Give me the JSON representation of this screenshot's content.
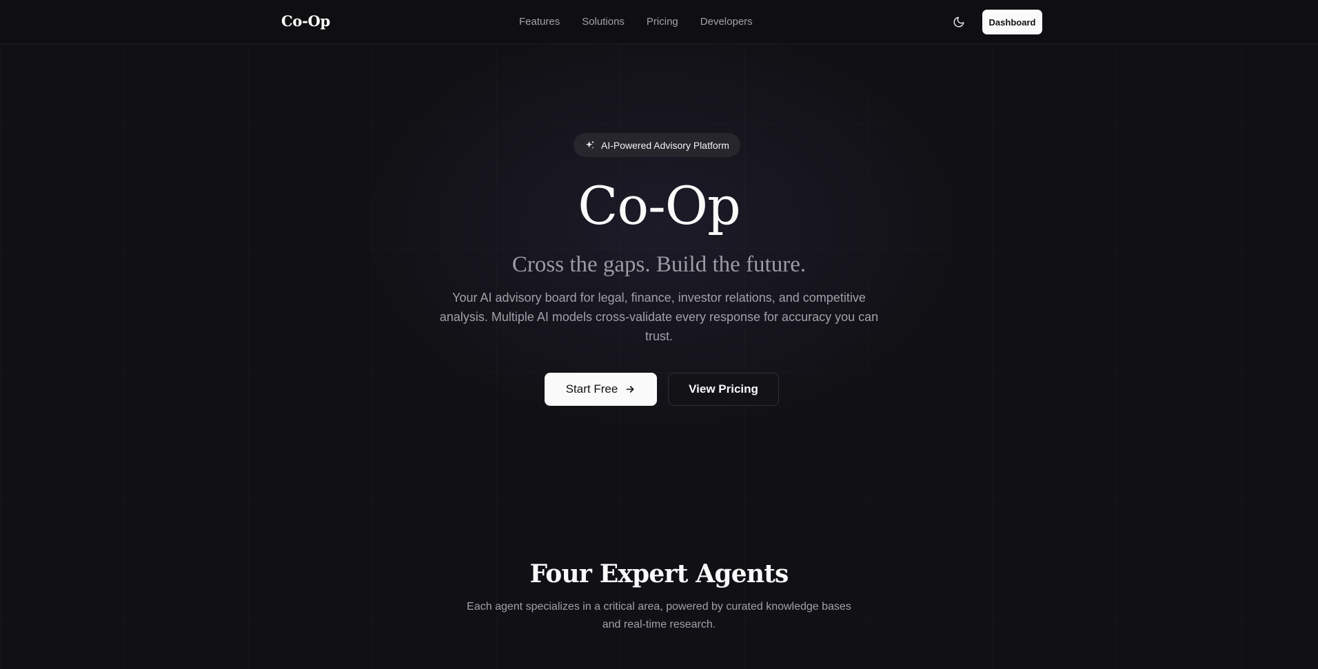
{
  "header": {
    "brand": "Co-Op",
    "nav": [
      {
        "label": "Features"
      },
      {
        "label": "Solutions"
      },
      {
        "label": "Pricing"
      },
      {
        "label": "Developers"
      }
    ],
    "theme_toggle_icon": "moon-icon",
    "dashboard_label": "Dashboard"
  },
  "hero": {
    "badge_icon": "sparkles-icon",
    "badge_label": "AI-Powered Advisory Platform",
    "title": "Co-Op",
    "subtitle": "Cross the gaps. Build the future.",
    "description": "Your AI advisory board for legal, finance, investor relations, and competitive analysis. Multiple AI models cross-validate every response for accuracy you can trust.",
    "primary_cta": "Start Free",
    "primary_cta_icon": "arrow-right-icon",
    "secondary_cta": "View Pricing"
  },
  "agents_section": {
    "title": "Four Expert Agents",
    "description": "Each agent specializes in a critical area, powered by curated knowledge bases and real-time research."
  },
  "colors": {
    "background": "#111115",
    "primary_button": "#fafafa",
    "muted_text": "#a1a1aa"
  }
}
